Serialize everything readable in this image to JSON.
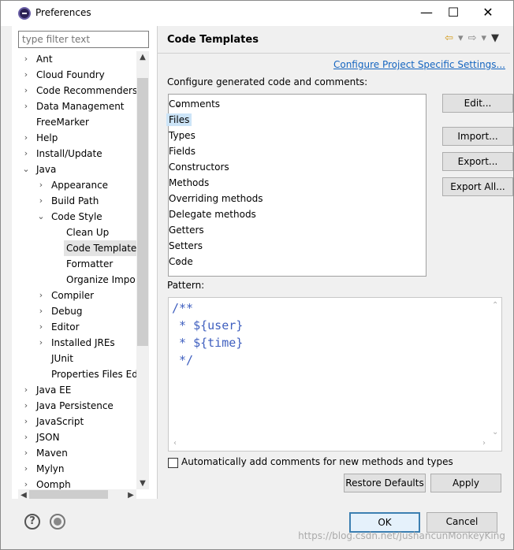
{
  "window": {
    "title": "Preferences",
    "minimize": "—",
    "maximize": "☐",
    "close": "✕"
  },
  "left": {
    "filter_placeholder": "type filter text",
    "tree": [
      {
        "label": "Ant",
        "twisty": "›",
        "level": 0
      },
      {
        "label": "Cloud Foundry",
        "twisty": "›",
        "level": 0
      },
      {
        "label": "Code Recommenders",
        "twisty": "›",
        "level": 0
      },
      {
        "label": "Data Management",
        "twisty": "›",
        "level": 0
      },
      {
        "label": "FreeMarker",
        "twisty": "",
        "level": 0
      },
      {
        "label": "Help",
        "twisty": "›",
        "level": 0
      },
      {
        "label": "Install/Update",
        "twisty": "›",
        "level": 0
      },
      {
        "label": "Java",
        "twisty": "⌄",
        "level": 0
      },
      {
        "label": "Appearance",
        "twisty": "›",
        "level": 1
      },
      {
        "label": "Build Path",
        "twisty": "›",
        "level": 1
      },
      {
        "label": "Code Style",
        "twisty": "⌄",
        "level": 1
      },
      {
        "label": "Clean Up",
        "twisty": "",
        "level": 2
      },
      {
        "label": "Code Template",
        "twisty": "",
        "level": 2,
        "selected": true
      },
      {
        "label": "Formatter",
        "twisty": "",
        "level": 2
      },
      {
        "label": "Organize Impo",
        "twisty": "",
        "level": 2
      },
      {
        "label": "Compiler",
        "twisty": "›",
        "level": 1
      },
      {
        "label": "Debug",
        "twisty": "›",
        "level": 1
      },
      {
        "label": "Editor",
        "twisty": "›",
        "level": 1
      },
      {
        "label": "Installed JREs",
        "twisty": "›",
        "level": 1
      },
      {
        "label": "JUnit",
        "twisty": "",
        "level": 1
      },
      {
        "label": "Properties Files Ed",
        "twisty": "",
        "level": 1
      },
      {
        "label": "Java EE",
        "twisty": "›",
        "level": 0
      },
      {
        "label": "Java Persistence",
        "twisty": "›",
        "level": 0
      },
      {
        "label": "JavaScript",
        "twisty": "›",
        "level": 0
      },
      {
        "label": "JSON",
        "twisty": "›",
        "level": 0
      },
      {
        "label": "Maven",
        "twisty": "›",
        "level": 0
      },
      {
        "label": "Mylyn",
        "twisty": "›",
        "level": 0
      },
      {
        "label": "Oomph",
        "twisty": "›",
        "level": 0
      }
    ]
  },
  "right": {
    "title": "Code Templates",
    "nav": {
      "back": "⇦",
      "dd1": "▾",
      "forward": "⇨",
      "dd2": "▾",
      "menu": "▼"
    },
    "config_link": "Configure Project Specific Settings...",
    "generate_label": "Configure generated code and comments:",
    "templates": [
      {
        "label": "Comments",
        "twisty": "⌄",
        "level": 0
      },
      {
        "label": "Files",
        "twisty": "",
        "level": 1,
        "selected": true
      },
      {
        "label": "Types",
        "twisty": "",
        "level": 1
      },
      {
        "label": "Fields",
        "twisty": "",
        "level": 1
      },
      {
        "label": "Constructors",
        "twisty": "",
        "level": 1
      },
      {
        "label": "Methods",
        "twisty": "",
        "level": 1
      },
      {
        "label": "Overriding methods",
        "twisty": "",
        "level": 1
      },
      {
        "label": "Delegate methods",
        "twisty": "",
        "level": 1
      },
      {
        "label": "Getters",
        "twisty": "",
        "level": 1
      },
      {
        "label": "Setters",
        "twisty": "",
        "level": 1
      },
      {
        "label": "Code",
        "twisty": "›",
        "level": 0
      }
    ],
    "buttons": {
      "edit": "Edit...",
      "import": "Import...",
      "export": "Export...",
      "export_all": "Export All..."
    },
    "pattern_label": "Pattern:",
    "pattern_code": "/**\n * ${user}\n * ${time}\n */",
    "auto_comments_label": "Automatically add comments for new methods and types",
    "auto_comments_checked": false,
    "restore_defaults": "Restore Defaults",
    "apply": "Apply"
  },
  "bottom": {
    "ok": "OK",
    "cancel": "Cancel",
    "watermark": "https://blog.csdn.net/JushancunMonkeyKing"
  }
}
